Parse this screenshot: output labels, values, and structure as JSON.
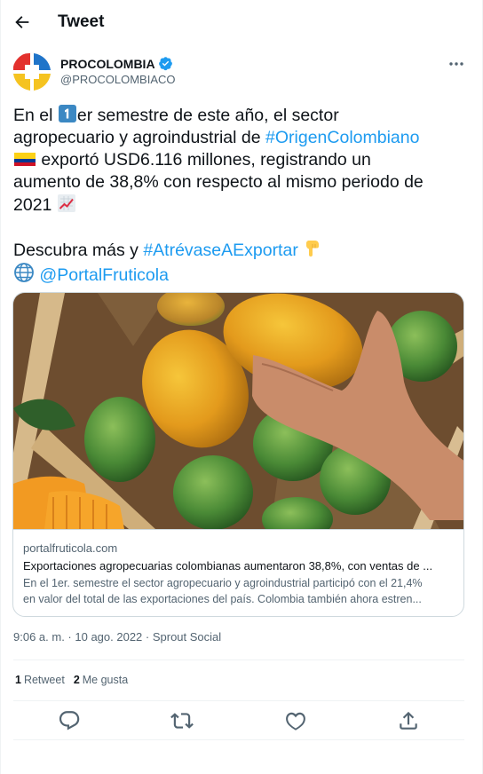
{
  "header": {
    "title": "Tweet",
    "back_icon": "arrow-left-icon"
  },
  "author": {
    "name": "PROCOLOMBIA",
    "handle": "@PROCOLOMBIACO",
    "verified_icon": "verified-badge-icon",
    "badge_color": "#1d9bf0"
  },
  "tweet": {
    "l1_a": "En el ",
    "l1_b": "er semestre de este año, el sector",
    "l2_a": "agropecuario y agroindustrial de ",
    "l2_hashtag": "#OrigenColombiano",
    "l3_b": " exportó USD6.116 millones, registrando un",
    "l4": "aumento de 38,8% con respecto al mismo periodo de",
    "l5": "2021 ",
    "l7_a": "Descubra más y ",
    "l7_hashtag": "#AtrévaseAExportar",
    "l8_mention": "@PortalFruticola"
  },
  "card": {
    "domain": "portalfruticola.com",
    "title": "Exportaciones agropecuarias colombianas aumentaron 38,8%, con ventas de ...",
    "desc_1": "En el 1er. semestre el sector agropecuario y agroindustrial participó con el 21,4%",
    "desc_2": "en valor del total de las exportaciones del país. Colombia también ahora estren..."
  },
  "meta": {
    "time": "9:06 a. m.",
    "sep1": " · ",
    "date": "10 ago. 2022",
    "sep2": " · ",
    "source": "Sprout Social"
  },
  "stats": {
    "retweets_count": "1",
    "retweets_label": "Retweet",
    "likes_count": "2",
    "likes_label": "Me gusta"
  },
  "actions": [
    "reply-icon",
    "retweet-icon",
    "like-icon",
    "share-icon"
  ],
  "colors": {
    "link": "#1d9bf0",
    "secondary_text": "#536471",
    "border": "#cfd9de"
  }
}
